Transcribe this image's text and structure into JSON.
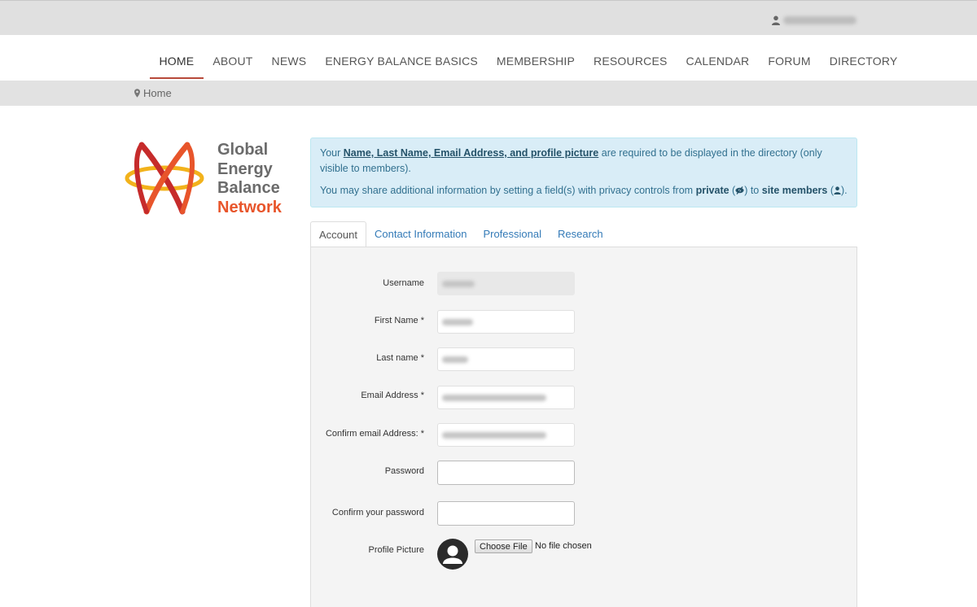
{
  "nav": {
    "items": [
      "HOME",
      "ABOUT",
      "NEWS",
      "ENERGY BALANCE BASICS",
      "MEMBERSHIP",
      "RESOURCES",
      "CALENDAR",
      "FORUM",
      "DIRECTORY"
    ],
    "active": "HOME"
  },
  "breadcrumb": {
    "home": "Home"
  },
  "logo": {
    "line1": "Global",
    "line2": "Energy",
    "line3": "Balance",
    "line4": "Network",
    "colors": {
      "red": "#c62b2b",
      "orange": "#e8552b",
      "yellow": "#f2b21b",
      "gray": "#6b6b6b"
    }
  },
  "notice": {
    "p1_prefix": "Your ",
    "p1_link": "Name, Last Name, Email Address, and profile picture",
    "p1_suffix": " are required to be displayed in the directory (only visible to members).",
    "p2_prefix": "You may share additional information by setting a field(s) with privacy controls from ",
    "p2_private": "private",
    "p2_mid": ") to ",
    "p2_site": "site members",
    "p2_end": ")."
  },
  "tabs": [
    "Account",
    "Contact Information",
    "Professional",
    "Research"
  ],
  "form": {
    "username_label": "Username",
    "first_name_label": "First Name *",
    "last_name_label": "Last name *",
    "email_label": "Email Address *",
    "confirm_email_label": "Confirm email Address: *",
    "password_label": "Password",
    "confirm_password_label": "Confirm your password",
    "profile_picture_label": "Profile Picture",
    "choose_file": "Choose File",
    "no_file": "No file chosen"
  },
  "colors": {
    "topbar": "#e0e0e0",
    "active_underline": "#b84a3a",
    "alert_bg": "#d9edf7",
    "alert_text": "#31708f",
    "tab_link": "#337ab7",
    "panel_bg": "#f4f4f4"
  },
  "icons": {
    "user": "user-icon",
    "marker": "map-marker-icon",
    "eye_slash": "eye-slash-icon",
    "avatar": "avatar-placeholder-icon"
  }
}
